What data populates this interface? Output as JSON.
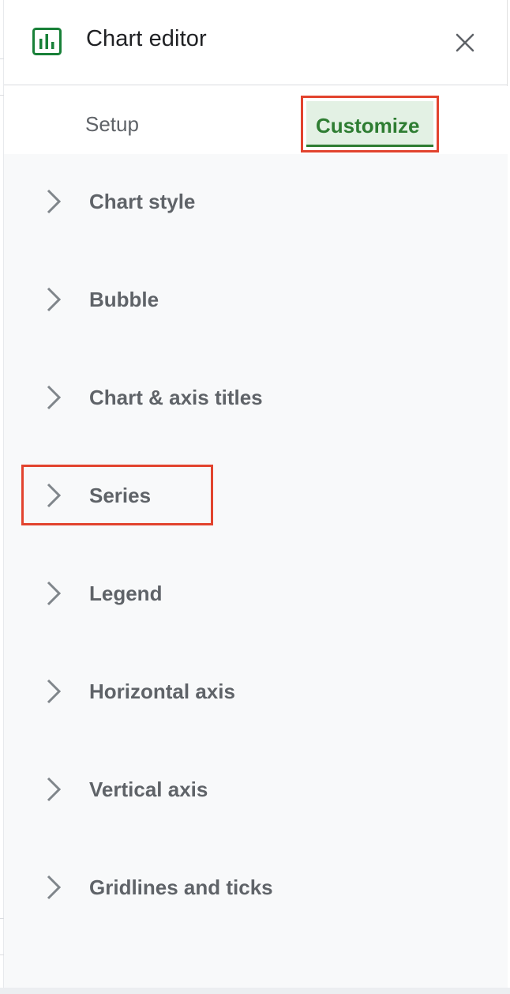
{
  "header": {
    "title": "Chart editor",
    "icon": "bar-chart-icon",
    "close_icon": "close-icon"
  },
  "tabs": [
    {
      "label": "Setup",
      "selected": false
    },
    {
      "label": "Customize",
      "selected": true
    }
  ],
  "sections": [
    {
      "label": "Chart style"
    },
    {
      "label": "Bubble"
    },
    {
      "label": "Chart & axis titles"
    },
    {
      "label": "Series"
    },
    {
      "label": "Legend"
    },
    {
      "label": "Horizontal axis"
    },
    {
      "label": "Vertical axis"
    },
    {
      "label": "Gridlines and ticks"
    }
  ],
  "colors": {
    "accent_green": "#2e7d32",
    "selected_tab_bg": "#e3f1e4",
    "highlight_red": "#e2432e",
    "panel_bg": "#f8f9fa",
    "text_gray": "#5f6368"
  }
}
